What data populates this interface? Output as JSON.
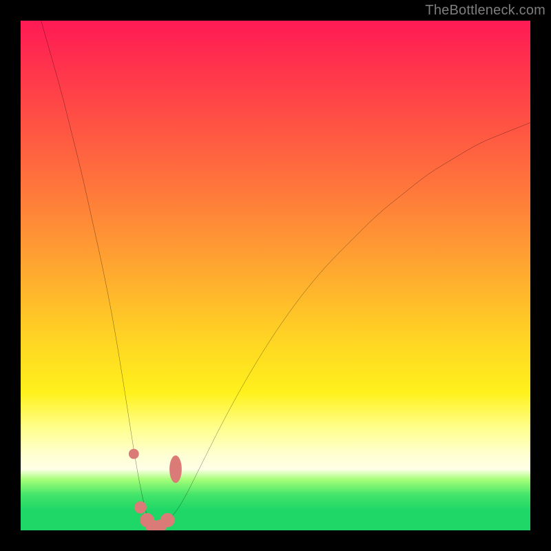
{
  "watermark": "TheBottleneck.com",
  "chart_data": {
    "type": "line",
    "title": "",
    "xlabel": "",
    "ylabel": "",
    "xlim": [
      0,
      100
    ],
    "ylim": [
      0,
      100
    ],
    "series": [
      {
        "name": "bottleneck-curve",
        "x": [
          4,
          6,
          8,
          10,
          12,
          14,
          16,
          18,
          20,
          22,
          23,
          24,
          25,
          26,
          27,
          28,
          30,
          32,
          35,
          40,
          45,
          50,
          55,
          60,
          65,
          70,
          75,
          80,
          85,
          90,
          95,
          100
        ],
        "y": [
          100,
          93,
          86,
          78,
          70,
          61,
          52,
          42,
          30,
          17,
          11,
          6,
          2,
          0,
          0,
          1,
          3,
          6,
          12,
          22,
          31,
          39,
          46,
          52,
          57,
          62,
          66,
          70,
          73,
          76,
          78,
          80
        ]
      }
    ],
    "markers": [
      {
        "name": "left-shoulder-dot",
        "x": 22.2,
        "y": 15,
        "r": 1.0
      },
      {
        "name": "left-floor-dot-1",
        "x": 23.5,
        "y": 4.5,
        "r": 1.2
      },
      {
        "name": "left-floor-dot-2",
        "x": 24.8,
        "y": 2.0,
        "r": 1.4
      },
      {
        "name": "min-dot-1",
        "x": 25.8,
        "y": 0.8,
        "r": 1.3
      },
      {
        "name": "min-dot-2",
        "x": 27.3,
        "y": 0.8,
        "r": 1.3
      },
      {
        "name": "right-floor-dot",
        "x": 28.8,
        "y": 2.0,
        "r": 1.4
      },
      {
        "name": "right-shoulder-pill",
        "x": 30.4,
        "y": 12,
        "rx": 1.2,
        "ry": 2.7
      }
    ],
    "gradient_stops": [
      {
        "pct": 0,
        "color": "#ff1a54"
      },
      {
        "pct": 30,
        "color": "#ff6e3d"
      },
      {
        "pct": 62,
        "color": "#ffd324"
      },
      {
        "pct": 85,
        "color": "#ffffd0"
      },
      {
        "pct": 93,
        "color": "#44e56a"
      },
      {
        "pct": 100,
        "color": "#1fd767"
      }
    ]
  }
}
